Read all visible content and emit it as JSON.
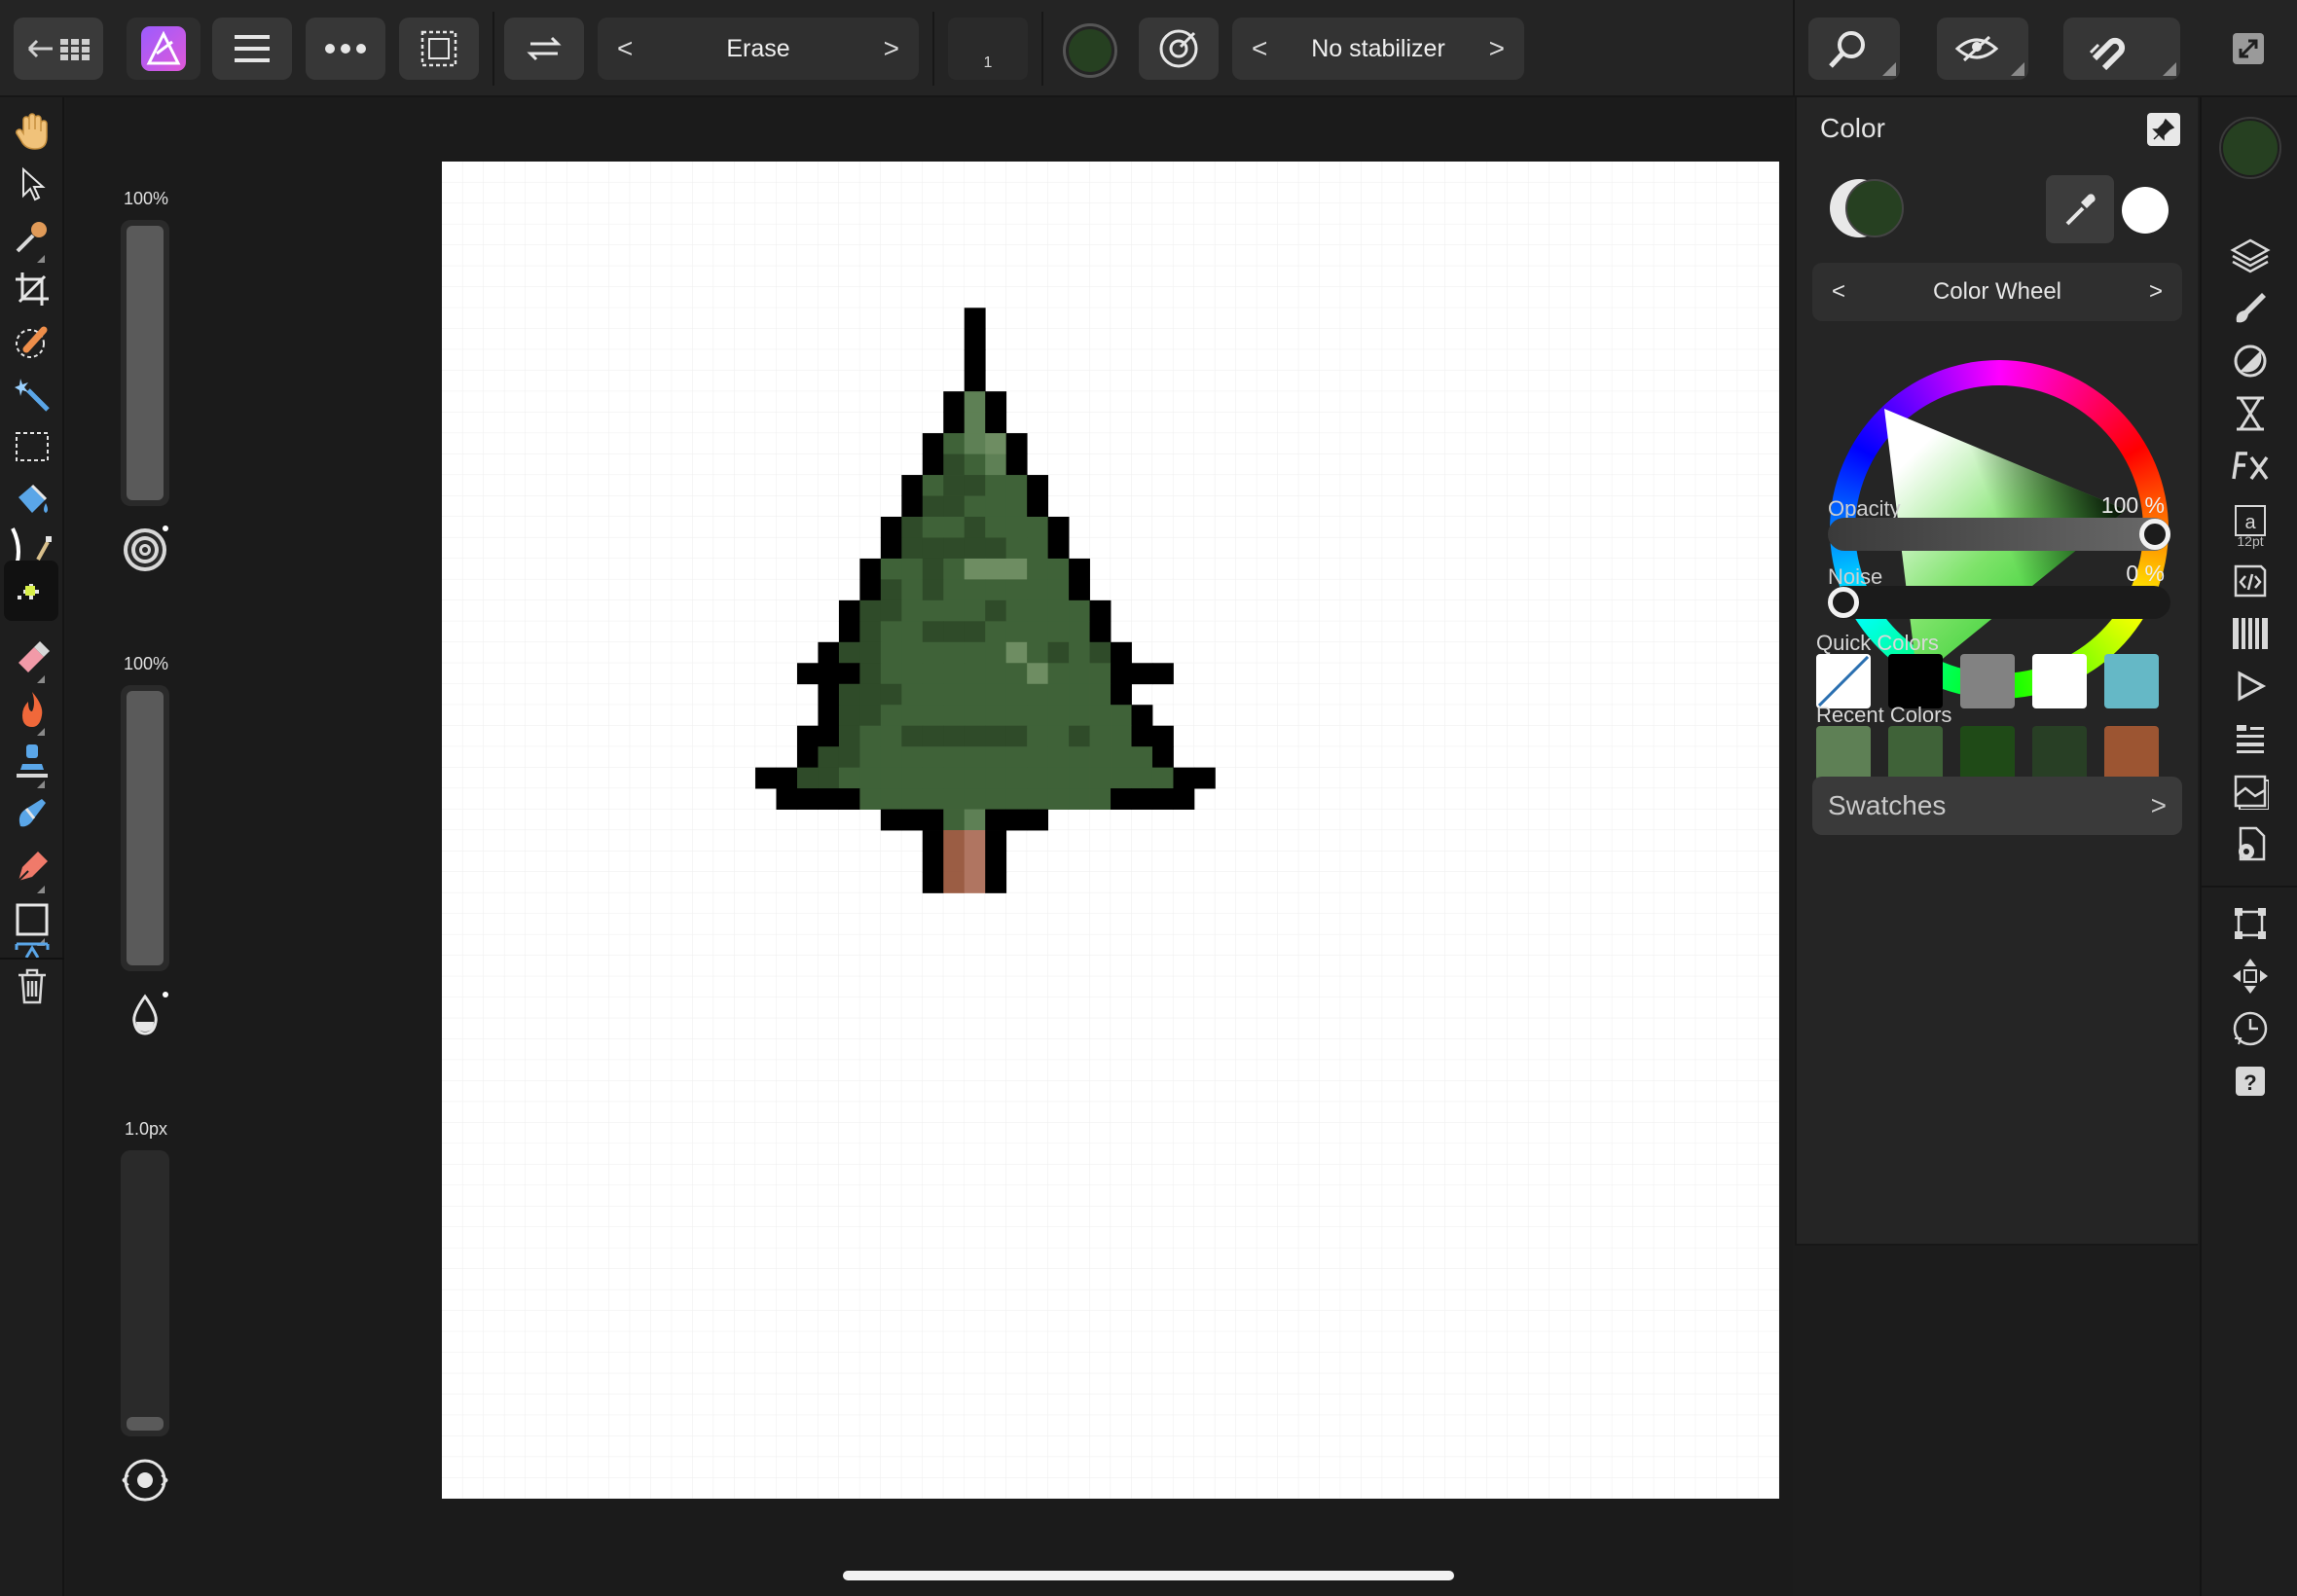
{
  "topbar": {
    "back_icon": "back-to-gallery-icon",
    "app_icon": "affinity-designer-logo",
    "menu_icon": "hamburger-menu-icon",
    "more_icon": "more-dots-icon",
    "selection_icon": "marquee-selection-icon",
    "flip_icon": "flip-swap-icon",
    "tool_mode": {
      "prev": "<",
      "label": "Erase",
      "next": ">"
    },
    "brush_width_value": "1",
    "current_color": "#264021",
    "force_icon": "pressure-target-icon",
    "stabilizer": {
      "prev": "<",
      "label": "No stabilizer",
      "next": ">"
    },
    "right_icons": [
      "zoom-view-icon",
      "view-mode-eye-icon",
      "snapping-magnet-icon",
      "fullscreen-icon"
    ]
  },
  "left_tools": [
    "hand-tool-icon",
    "move-pointer-icon",
    "color-picker-icon",
    "crop-icon",
    "selection-brush-icon",
    "magic-wand-icon",
    "marquee-rect-icon",
    "flood-fill-icon",
    "pixel-tool-icon",
    "pixel-grid-tool-icon",
    "eraser-icon",
    "burn-flame-icon",
    "clone-stamp-icon",
    "smudge-brush-icon",
    "pen-tool-icon",
    "rectangle-tool-icon",
    "text-frame-icon",
    "trash-icon"
  ],
  "context": {
    "opacity_label": "100%",
    "opacity_value": 1.0,
    "flow_label": "100%",
    "flow_value": 1.0,
    "width_label": "1.0px",
    "width_value": 0.02
  },
  "color_panel": {
    "title": "Color",
    "mode_bar": {
      "prev": "<",
      "label": "Color Wheel",
      "next": ">"
    },
    "primary_color": "#264021",
    "secondary_color": "#e8e8e8",
    "picker_fill": "#ffffff",
    "opacity_label": "Opacity",
    "opacity_value": "100 %",
    "opacity_fraction": 1.0,
    "noise_label": "Noise",
    "noise_value": "0 %",
    "noise_fraction": 0.0,
    "quick_colors_label": "Quick Colors",
    "quick_colors": [
      "none",
      "#000000",
      "#828282",
      "#ffffff",
      "#65b8c6"
    ],
    "recent_colors_label": "Recent Colors",
    "recent_colors": [
      "#5e8055",
      "#3f6238",
      "#1f4a17",
      "#283f25",
      "#9c5532"
    ],
    "swatches_label": "Swatches",
    "swatches_chevron": ">"
  },
  "right_studio": [
    "color-swatch-icon",
    "layers-icon",
    "brushes-icon",
    "adjustments-icon",
    "history-hourglass-icon",
    "fx-icon",
    "text-style-icon",
    "code-snippet-icon",
    "channels-piano-icon",
    "play-macro-icon",
    "navigator-icon",
    "document-icon",
    "settings-gear-icon",
    "transform-icon",
    "move-arrows-icon",
    "history-clock-icon",
    "help-icon"
  ],
  "text_style_size": "12pt",
  "canvas": {
    "pixel_art": [
      "..........#..........",
      "..........#..........",
      "..........#..........",
      "..........#..........",
      ".........#M#.........",
      ".........#M#.........",
      "........#mML#........",
      "........#dmM#........",
      ".......#mddmm#.......",
      ".......#ddmmm#.......",
      "......#dmmdmmm#......",
      "......#dddddmm#......",
      ".....#mmdmLLLmm#.....",
      ".....#dmdmmmmmm#.....",
      "....#ddmmmmdmmmm#....",
      "....#dmmdddmmmmm#....",
      "...#ddmmmmmmLmdmd#...",
      "..###dmmmmmmmLmmm###.",
      "...#dddmmmmmmmmmm#...",
      "...#ddmmmmmmmmmmmm#..",
      "..##dmmddddddmmdmm##.",
      "..#ddmmmmmmmmmmmmmm#.",
      "##ddmmmmmmmmmmmmmmmm##",
      ".####mmmmmmmmmmmm####.",
      "......###mM###.......",
      "........#bB#.........",
      "........#bB#.........",
      "........#bB#........."
    ],
    "palette": {
      "#": "#000000",
      "d": "#2f4b29",
      "m": "#3f6238",
      "M": "#5e8055",
      "L": "#6e8d62",
      "b": "#9b5d44",
      "B": "#b07561"
    }
  }
}
